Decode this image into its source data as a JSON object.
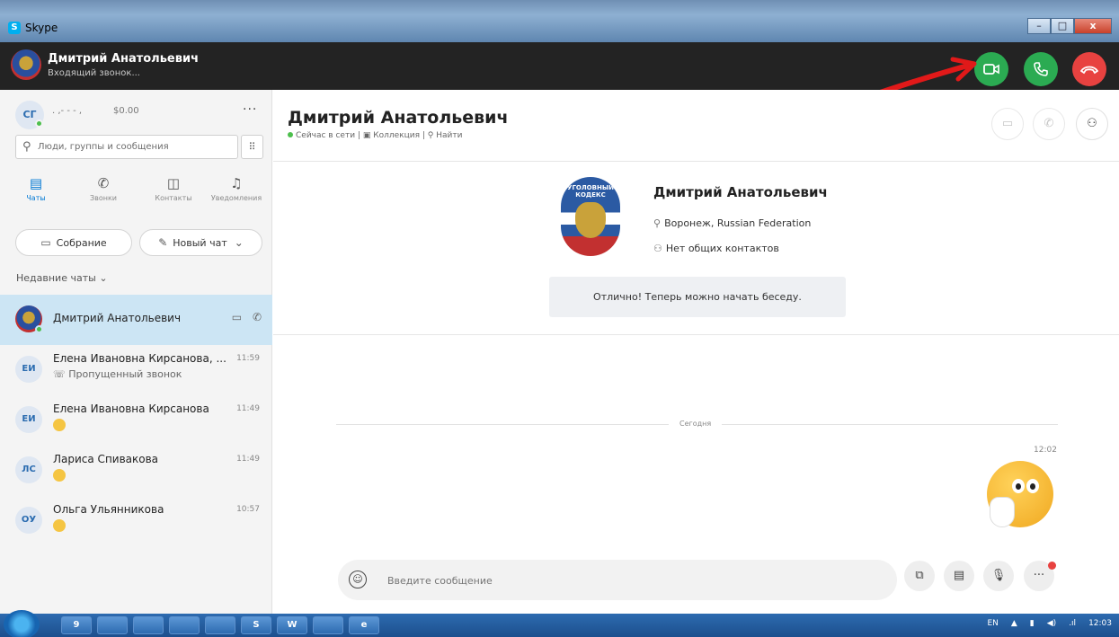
{
  "window": {
    "title": "Skype",
    "minimize_glyph": "–",
    "maximize_glyph": "□",
    "close_glyph": "x"
  },
  "incoming_call": {
    "caller_name": "Дмитрий Анатольевич",
    "status": "Входящий звонок...",
    "video_icon": "video-camera-icon",
    "answer_icon": "phone-icon",
    "decline_icon": "hang-up-icon",
    "accent_green": "#2bab52",
    "accent_red": "#e84240"
  },
  "sidebar": {
    "me": {
      "initials": "СГ",
      "name": ". ,- - - ,",
      "credit": "$0.00",
      "more": "···"
    },
    "search": {
      "placeholder": "Люди, группы и сообщения"
    },
    "nav": [
      {
        "label": "Чаты",
        "icon": "chat-icon"
      },
      {
        "label": "Звонки",
        "icon": "phone-icon"
      },
      {
        "label": "Контакты",
        "icon": "contacts-icon"
      },
      {
        "label": "Уведомления",
        "icon": "bell-icon"
      }
    ],
    "meet_button": "Собрание",
    "new_chat_button": "Новый чат",
    "recent_label": "Недавние чаты",
    "chats": [
      {
        "initials": "",
        "name": "Дмитрий Анатольевич",
        "time": "",
        "sub": ""
      },
      {
        "initials": "ЕИ",
        "name": "Елена Ивановна Кирсанова, ...",
        "time": "11:59",
        "sub": "Пропущенный звонок"
      },
      {
        "initials": "ЕИ",
        "name": "Елена Ивановна Кирсанова",
        "time": "11:49",
        "sub": ""
      },
      {
        "initials": "ЛС",
        "name": "Лариса Спивакова",
        "time": "11:49",
        "sub": ""
      },
      {
        "initials": "ОУ",
        "name": "Ольга Ульянникова",
        "time": "10:57",
        "sub": ""
      }
    ]
  },
  "conversation": {
    "title": "Дмитрий Анатольевич",
    "status_online": "Сейчас в сети",
    "collection": "Коллекция",
    "find": "Найти",
    "profile": {
      "name": "Дмитрий Анатольевич",
      "photo_text": "УГОЛОВНЫЙ КОДЕКС",
      "location": "Воронеж, Russian Federation",
      "contacts": "Нет общих контактов",
      "notice": "Отлично! Теперь можно начать беседу."
    },
    "date_separator": "Сегодня",
    "message_time": "12:02",
    "composer_placeholder": "Введите сообщение"
  },
  "taskbar": {
    "apps": [
      "9",
      "",
      "",
      "",
      "",
      "S",
      "W",
      "",
      "e"
    ],
    "lang": "EN",
    "clock": "12:03"
  }
}
